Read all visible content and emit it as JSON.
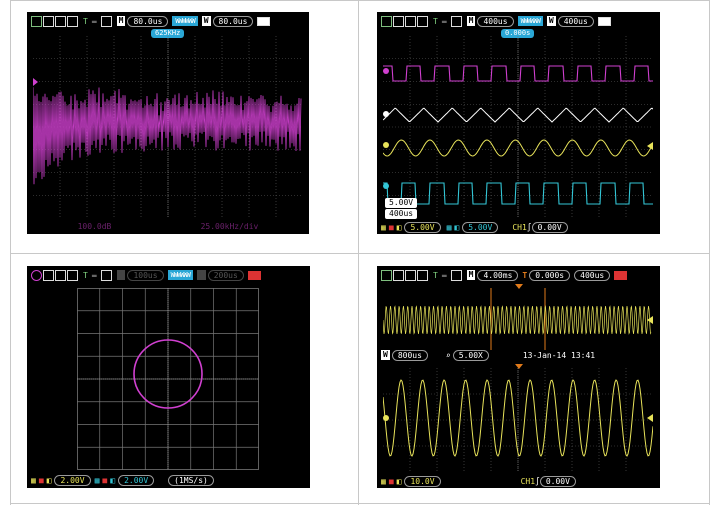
{
  "colors": {
    "magenta": "#d040d0",
    "yellow": "#e8e35a",
    "cyan": "#33c6d6",
    "white": "#ffffff",
    "marker_blue": "#2aa7d6",
    "orange": "#e07a1a"
  },
  "panels": {
    "tl": {
      "trigger_mode": "T",
      "main_label": "M",
      "main_time": "80.0us",
      "window_label": "W",
      "window_time": "80.0us",
      "wave_strip": "WWWWWW",
      "marker": "625KHz",
      "footer_left": "100.0dB",
      "footer_right": "25.00kHz/div"
    },
    "tr": {
      "trigger_mode": "T",
      "main_label": "M",
      "main_time": "400us",
      "window_label": "W",
      "window_time": "400us",
      "wave_strip": "WWWWWW",
      "marker": "0.000s",
      "info_line1": "5.00V",
      "info_line2": "400us",
      "ch1_scale": "5.00V",
      "ch2_scale": "5.00V",
      "ch1_label": "CH1",
      "trigger_level": "0.00V"
    },
    "bl": {
      "trigger_mode": "T",
      "main_time": "100us",
      "wave_strip": "WWWWWW",
      "window_time": "200us",
      "ch1_scale": "2.00V",
      "ch2_scale": "2.00V",
      "sample_rate": "(1MS/s)"
    },
    "br": {
      "trigger_mode": "T",
      "main_label": "M",
      "main_time": "4.00ms",
      "trig_offset": "0.000s",
      "window_time": "400us",
      "zoom_label": "W",
      "zoom_time": "800us",
      "zoom_factor": "5.00X",
      "datetime": "13-Jan-14 13:41",
      "ch1_scale": "10.0V",
      "ch1_label": "CH1",
      "trigger_level": "0.00V"
    }
  }
}
